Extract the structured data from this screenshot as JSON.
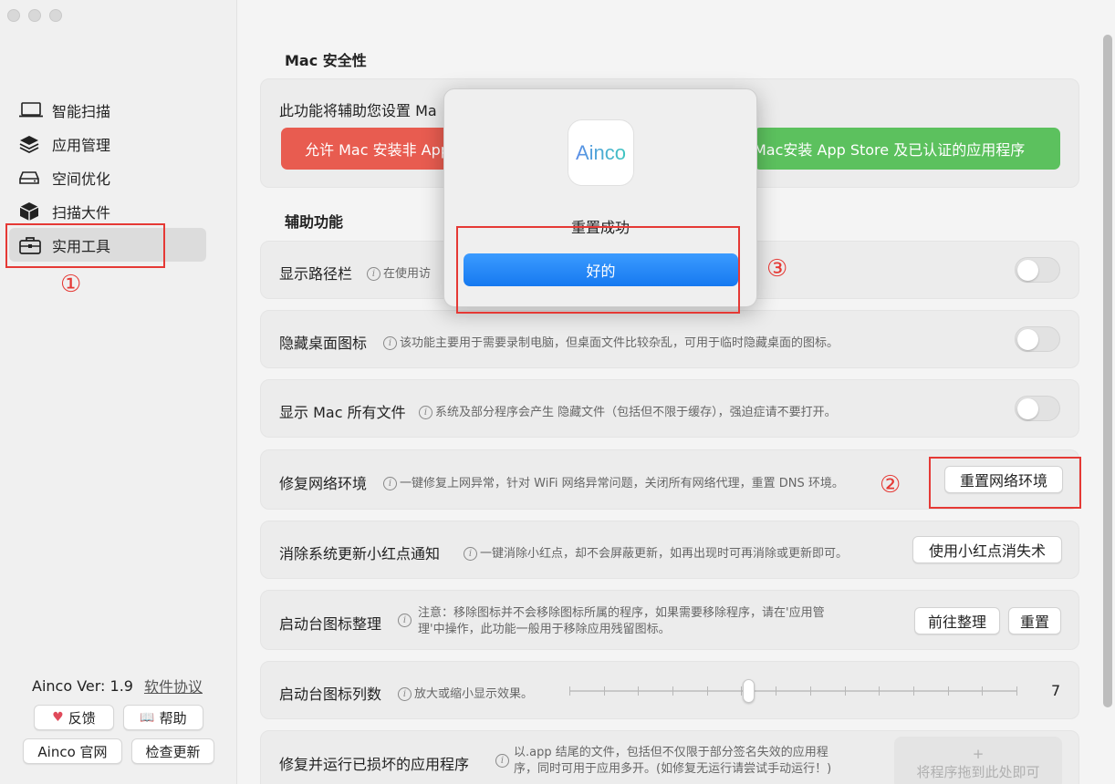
{
  "sidebar": {
    "items": [
      {
        "label": "智能扫描",
        "icon": "laptop-icon"
      },
      {
        "label": "应用管理",
        "icon": "layers-icon"
      },
      {
        "label": "空间优化",
        "icon": "disk-icon"
      },
      {
        "label": "扫描大件",
        "icon": "cube-icon"
      },
      {
        "label": "实用工具",
        "icon": "toolbox-icon"
      }
    ],
    "version": "Ainco Ver: 1.9",
    "license_link": "软件协议",
    "feedback": "反馈",
    "help": "帮助",
    "official": "Ainco 官网",
    "check_update": "检查更新"
  },
  "main": {
    "security_title": "Mac 安全性",
    "security_desc": "此功能将辅助您设置 Ma",
    "allow_btn": "允许 Mac 安装非 App",
    "store_btn": "Mac安装 App Store 及已认证的应用程序",
    "assist_title": "辅助功能",
    "rows": [
      {
        "label": "显示路径栏",
        "desc": "在使用访"
      },
      {
        "label": "隐藏桌面图标",
        "desc": "该功能主要用于需要录制电脑，但桌面文件比较杂乱，可用于临时隐藏桌面的图标。"
      },
      {
        "label": "显示 Mac 所有文件",
        "desc": "系统及部分程序会产生 隐藏文件（包括但不限于缓存），强迫症请不要打开。"
      },
      {
        "label": "修复网络环境",
        "desc": "一键修复上网异常，针对 WiFi 网络异常问题，关闭所有网络代理，重置 DNS 环境。",
        "button": "重置网络环境"
      },
      {
        "label": "消除系统更新小红点通知",
        "desc": "一键消除小红点，却不会屏蔽更新，如再出现时可再消除或更新即可。",
        "button": "使用小红点消失术"
      },
      {
        "label": "启动台图标整理",
        "desc_line1": "注意：移除图标并不会移除图标所属的程序，如果需要移除程序，请在'应用管",
        "desc_line2": "理'中操作，此功能一般用于移除应用残留图标。",
        "button1": "前往整理",
        "button2": "重置"
      },
      {
        "label": "启动台图标列数",
        "desc": "放大或缩小显示效果。",
        "value": "7",
        "slider_fraction": 0.4
      },
      {
        "label": "修复并运行已损坏的应用程序",
        "desc_line1": "以.app 结尾的文件，包括但不仅限于部分签名失效的应用程",
        "desc_line2": "序，同时可用于应用多开。(如修复无运行请尝试手动运行！)",
        "drop_plus": "+",
        "drop_text": "将程序拖到此处即可"
      }
    ]
  },
  "modal": {
    "app_name": "Ainco",
    "message": "重置成功",
    "ok": "好的"
  },
  "annotations": [
    "①",
    "②",
    "③"
  ],
  "colors": {
    "red_button": "#e85c50",
    "green_button": "#5cc15e",
    "accent_blue": "#1a7cf2",
    "annotation_red": "#e53935"
  }
}
